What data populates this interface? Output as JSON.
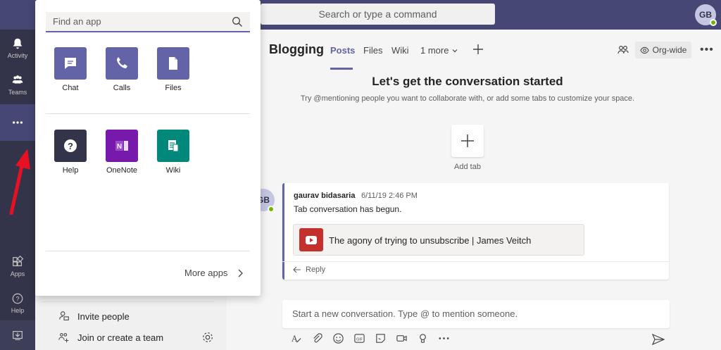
{
  "topbar": {
    "search_placeholder": "Search or type a command",
    "avatar_initials": "GB"
  },
  "rail": {
    "items": [
      {
        "label": "Activity",
        "icon": "bell-icon"
      },
      {
        "label": "Teams",
        "icon": "teams-icon"
      },
      {
        "label": "",
        "icon": "more-icon"
      },
      {
        "label": "Apps",
        "icon": "apps-icon"
      },
      {
        "label": "Help",
        "icon": "help-icon"
      },
      {
        "label": "",
        "icon": "download-icon"
      }
    ]
  },
  "team_panel": {
    "invite_label": "Invite people",
    "join_label": "Join or create a team"
  },
  "channel": {
    "title": "Blogging",
    "tabs": [
      "Posts",
      "Files",
      "Wiki",
      "1 more"
    ],
    "orgwide_label": "Org-wide"
  },
  "conversation": {
    "heading": "Let's get the conversation started",
    "subtext": "Try @mentioning people you want to collaborate with, or add some tabs to customize your space.",
    "add_tab_label": "Add tab"
  },
  "message": {
    "avatar_initials": "GB",
    "author": "gaurav bidasaria",
    "timestamp": "6/11/19 2:46 PM",
    "text": "Tab conversation has begun.",
    "link_title": "The agony of trying to unsubscribe | James Veitch",
    "reply_label": "Reply"
  },
  "compose": {
    "placeholder": "Start a new conversation. Type @ to mention someone."
  },
  "popup": {
    "search_placeholder": "Find an app",
    "apps_row1": [
      {
        "label": "Chat",
        "icon": "chat-icon",
        "color": "#6264a7"
      },
      {
        "label": "Calls",
        "icon": "phone-icon",
        "color": "#6264a7"
      },
      {
        "label": "Files",
        "icon": "file-icon",
        "color": "#6264a7"
      }
    ],
    "apps_row2": [
      {
        "label": "Help",
        "icon": "help-icon",
        "color": "#33344a"
      },
      {
        "label": "OneNote",
        "icon": "onenote-icon",
        "color": "#7719aa"
      },
      {
        "label": "Wiki",
        "icon": "wiki-icon",
        "color": "#00897b"
      }
    ],
    "more_apps_label": "More apps"
  },
  "colors": {
    "brand": "#6264a7",
    "topbar": "#464775",
    "rail": "#33344a",
    "presence": "#6bb700",
    "annotation_arrow": "#e81123"
  }
}
